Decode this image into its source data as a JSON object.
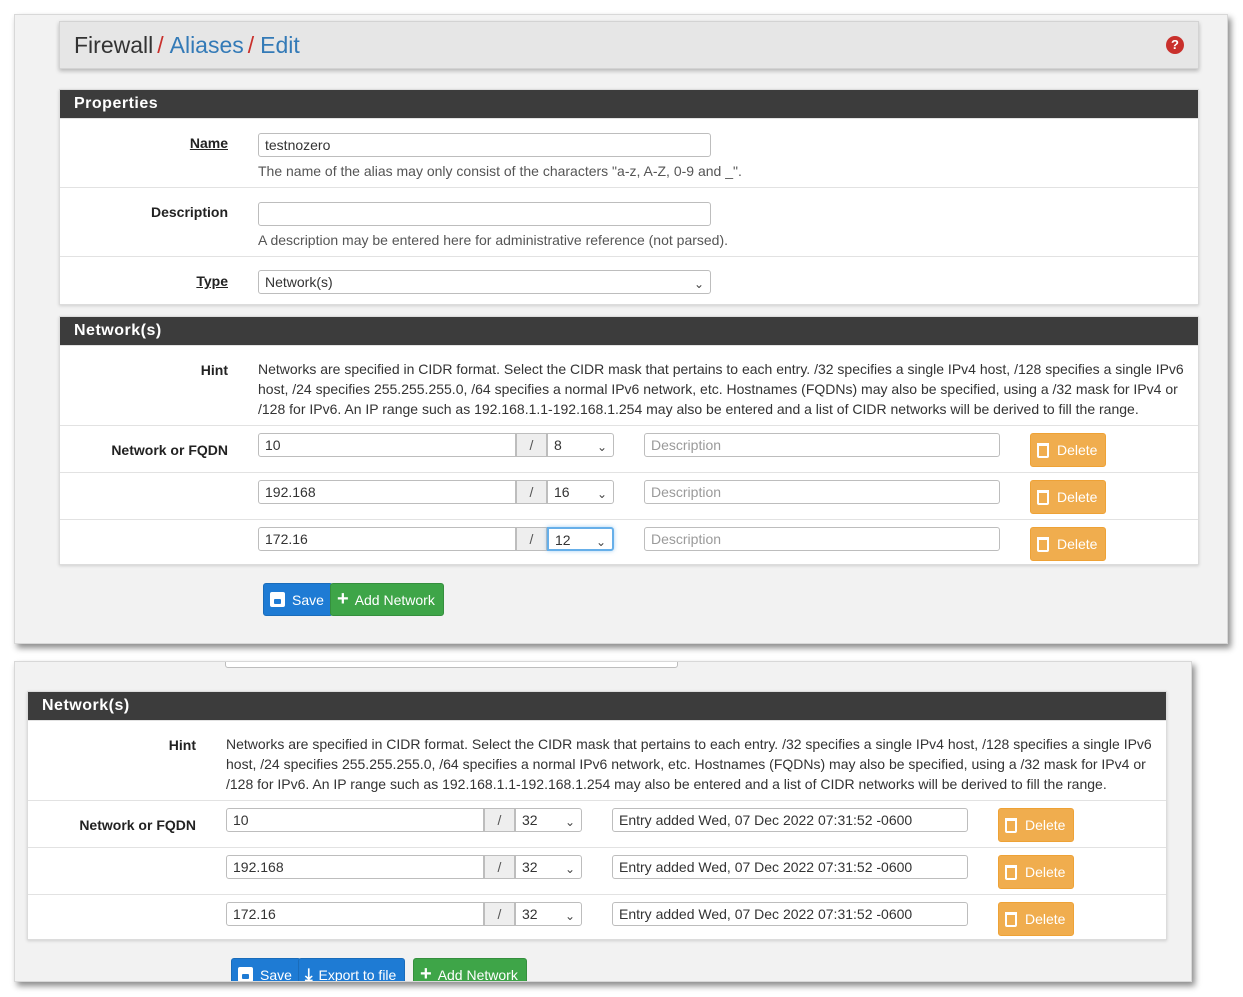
{
  "breadcrumb": {
    "firewall": "Firewall",
    "aliases": "Aliases",
    "edit": "Edit",
    "sep": "/",
    "help_glyph": "?"
  },
  "properties": {
    "title": "Properties",
    "name_label": "Name",
    "name_value": "testnozero",
    "name_help": "The name of the alias may only consist of the characters \"a-z, A-Z, 0-9 and _\".",
    "description_label": "Description",
    "description_value": "",
    "description_help": "A description may be entered here for administrative reference (not parsed).",
    "type_label": "Type",
    "type_value": "Network(s)"
  },
  "networks_top": {
    "title": "Network(s)",
    "hint_label": "Hint",
    "hint_text": "Networks are specified in CIDR format. Select the CIDR mask that pertains to each entry. /32 specifies a single IPv4 host, /128 specifies a single IPv6 host, /24 specifies 255.255.255.0, /64 specifies a normal IPv6 network, etc. Hostnames (FQDNs) may also be specified, using a /32 mask for IPv4 or /128 for IPv6. An IP range such as 192.168.1.1-192.168.1.254 may also be entered and a list of CIDR networks will be derived to fill the range.",
    "row_label": "Network or FQDN",
    "slash": "/",
    "delete_label": "Delete",
    "rows": [
      {
        "network": "10",
        "mask": "8",
        "description": "",
        "description_placeholder": "Description"
      },
      {
        "network": "192.168",
        "mask": "16",
        "description": "",
        "description_placeholder": "Description"
      },
      {
        "network": "172.16",
        "mask": "12",
        "description": "",
        "description_placeholder": "Description"
      }
    ],
    "save_label": "Save",
    "add_label": "Add Network"
  },
  "networks_bottom": {
    "title": "Network(s)",
    "hint_label": "Hint",
    "hint_text": "Networks are specified in CIDR format. Select the CIDR mask that pertains to each entry. /32 specifies a single IPv4 host, /128 specifies a single IPv6 host, /24 specifies 255.255.255.0, /64 specifies a normal IPv6 network, etc. Hostnames (FQDNs) may also be specified, using a /32 mask for IPv4 or /128 for IPv6. An IP range such as 192.168.1.1-192.168.1.254 may also be entered and a list of CIDR networks will be derived to fill the range.",
    "row_label": "Network or FQDN",
    "slash": "/",
    "delete_label": "Delete",
    "rows": [
      {
        "network": "10",
        "mask": "32",
        "description": "Entry added Wed, 07 Dec 2022 07:31:52 -0600"
      },
      {
        "network": "192.168",
        "mask": "32",
        "description": "Entry added Wed, 07 Dec 2022 07:31:52 -0600"
      },
      {
        "network": "172.16",
        "mask": "32",
        "description": "Entry added Wed, 07 Dec 2022 07:31:52 -0600"
      }
    ],
    "save_label": "Save",
    "export_label": "Export to file",
    "add_label": "Add Network"
  },
  "icons": {
    "help": "help-icon",
    "save": "save-icon",
    "trash": "trash-icon",
    "plus": "plus-icon",
    "download": "download-icon",
    "chevron": "chevron-down-icon"
  },
  "colors": {
    "panel_header": "#3c3c3c",
    "link": "#337ab7",
    "separator": "#c9302c",
    "save_button": "#1e7bd4",
    "add_button": "#3ea548",
    "delete_button": "#f0ad4e"
  }
}
